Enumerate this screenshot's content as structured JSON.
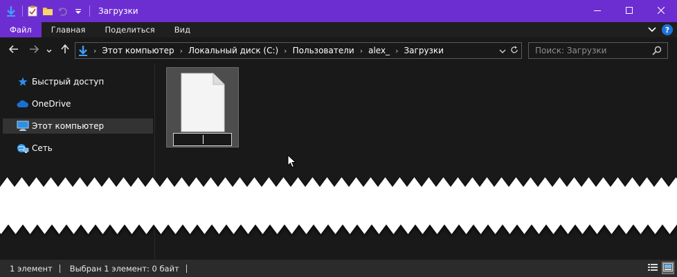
{
  "window": {
    "title": "Загрузки",
    "accent": "#6d2ed1"
  },
  "ribbon": {
    "tabs": [
      {
        "label": "Файл"
      },
      {
        "label": "Главная"
      },
      {
        "label": "Поделиться"
      },
      {
        "label": "Вид"
      }
    ],
    "help_label": "?"
  },
  "address_bar": {
    "breadcrumbs": [
      "Этот компьютер",
      "Локальный диск (C:)",
      "Пользователи",
      "alex_",
      "Загрузки"
    ]
  },
  "search": {
    "placeholder": "Поиск: Загрузки"
  },
  "sidebar": {
    "items": [
      {
        "label": "Быстрый доступ",
        "icon": "star-icon"
      },
      {
        "label": "OneDrive",
        "icon": "cloud-icon"
      },
      {
        "label": "Этот компьютер",
        "icon": "monitor-icon",
        "selected": true
      },
      {
        "label": "Сеть",
        "icon": "network-icon"
      }
    ]
  },
  "status": {
    "item_count": "1 элемент",
    "selection": "Выбран 1 элемент: 0 байт"
  }
}
